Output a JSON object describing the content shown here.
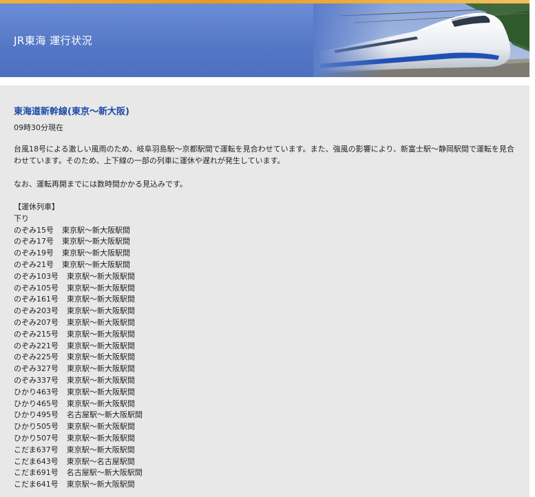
{
  "header": {
    "title": "JR東海 運行状況"
  },
  "main": {
    "line_title": "東海道新幹線(東京～新大阪)",
    "timestamp": "09時30分現在",
    "paragraph1": "台風18号による激しい風雨のため、岐阜羽島駅～京都駅間で運転を見合わせています。また、強風の影響により、新富士駅～静岡駅間で運転を見合わせています。そのため、上下線の一部の列車に運休や遅れが発生しています。",
    "paragraph2": "なお、運転再開までには数時間かかる見込みです。",
    "cancelled_heading": "【運休列車】",
    "direction": "下り",
    "trains": [
      {
        "name": "のぞみ15号",
        "segment": "東京駅～新大阪駅間"
      },
      {
        "name": "のぞみ17号",
        "segment": "東京駅～新大阪駅間"
      },
      {
        "name": "のぞみ19号",
        "segment": "東京駅～新大阪駅間"
      },
      {
        "name": "のぞみ21号",
        "segment": "東京駅～新大阪駅間"
      },
      {
        "name": "のぞみ103号",
        "segment": "東京駅～新大阪駅間"
      },
      {
        "name": "のぞみ105号",
        "segment": "東京駅～新大阪駅間"
      },
      {
        "name": "のぞみ161号",
        "segment": "東京駅～新大阪駅間"
      },
      {
        "name": "のぞみ203号",
        "segment": "東京駅～新大阪駅間"
      },
      {
        "name": "のぞみ207号",
        "segment": "東京駅～新大阪駅間"
      },
      {
        "name": "のぞみ215号",
        "segment": "東京駅～新大阪駅間"
      },
      {
        "name": "のぞみ221号",
        "segment": "東京駅～新大阪駅間"
      },
      {
        "name": "のぞみ225号",
        "segment": "東京駅～新大阪駅間"
      },
      {
        "name": "のぞみ327号",
        "segment": "東京駅～新大阪駅間"
      },
      {
        "name": "のぞみ337号",
        "segment": "東京駅～新大阪駅間"
      },
      {
        "name": "ひかり463号",
        "segment": "東京駅～新大阪駅間"
      },
      {
        "name": "ひかり465号",
        "segment": "東京駅～新大阪駅間"
      },
      {
        "name": "ひかり495号",
        "segment": "名古屋駅～新大阪駅間"
      },
      {
        "name": "ひかり505号",
        "segment": "東京駅～新大阪駅間"
      },
      {
        "name": "ひかり507号",
        "segment": "東京駅～新大阪駅間"
      },
      {
        "name": "こだま637号",
        "segment": "東京駅～新大阪駅間"
      },
      {
        "name": "こだま643号",
        "segment": "東京駅～名古屋駅間"
      },
      {
        "name": "こだま691号",
        "segment": "名古屋駅～新大阪駅間"
      },
      {
        "name": "こだま641号",
        "segment": "東京駅～新大阪駅間"
      }
    ]
  },
  "colors": {
    "header_blue": "#5578c6",
    "accent_orange": "#e89a1e",
    "title_blue": "#1a4aa8",
    "content_bg": "#e8e8e8"
  },
  "icons": {
    "header_image": "shinkansen-train-image"
  }
}
